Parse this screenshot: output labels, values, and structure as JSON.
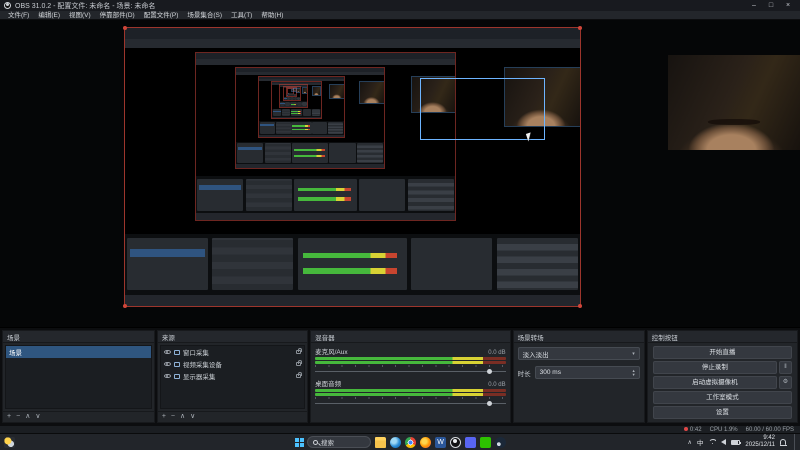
{
  "window": {
    "title": "OBS 31.0.2 - 配置文件: 未命名 - 场景: 未命名",
    "controls": {
      "minimize": "–",
      "maximize": "□",
      "close": "×"
    }
  },
  "menu": {
    "items": [
      "文件(F)",
      "编辑(E)",
      "视图(V)",
      "停靠部件(D)",
      "配置文件(P)",
      "场景集合(S)",
      "工具(T)",
      "帮助(H)"
    ]
  },
  "docks": {
    "scenes": {
      "title": "场景",
      "items": [
        {
          "label": "场景"
        }
      ],
      "toolbar": [
        "+",
        "−",
        "∧",
        "∨"
      ]
    },
    "sources": {
      "title": "来源",
      "items": [
        {
          "label": "窗口采集"
        },
        {
          "label": "视频采集设备"
        },
        {
          "label": "显示器采集"
        }
      ],
      "toolbar": [
        "+",
        "−",
        "∧",
        "∨"
      ]
    },
    "mixer": {
      "title": "混音器",
      "channels": [
        {
          "name": "麦克风/Aux",
          "db": "0.0 dB"
        },
        {
          "name": "桌面音频",
          "db": "0.0 dB"
        }
      ]
    },
    "transitions": {
      "title": "场景转场",
      "selected": "淡入淡出",
      "duration_label": "时长",
      "duration_value": "300 ms"
    },
    "controls": {
      "title": "控制按钮",
      "buttons": [
        "开始直播",
        "停止录制",
        "启动虚拟摄像机",
        "工作室模式",
        "设置"
      ],
      "pause_glyph": "‖",
      "gear_glyph": "⚙"
    }
  },
  "statusbar": {
    "rec_timer": "0:42",
    "cpu": "CPU 1.9%",
    "fps": "60.00 / 60.00 FPS"
  },
  "taskbar": {
    "search_label": "搜索",
    "ime": "中",
    "tray_chevron": "∧",
    "time": "9:42",
    "date": "2025/12/11"
  }
}
